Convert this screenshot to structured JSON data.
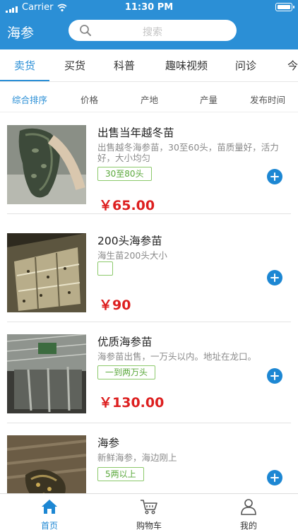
{
  "status_bar": {
    "carrier": "Carrier",
    "time": "11:30 PM"
  },
  "header": {
    "title": "海参",
    "search_placeholder": "搜索",
    "search_icon": "search-icon"
  },
  "tabs": [
    {
      "label": "卖货",
      "active": true
    },
    {
      "label": "买货"
    },
    {
      "label": "科普"
    },
    {
      "label": "趣味视频"
    },
    {
      "label": "问诊"
    },
    {
      "label": "今"
    }
  ],
  "sort_options": [
    {
      "label": "综合排序",
      "active": true
    },
    {
      "label": "价格"
    },
    {
      "label": "产地"
    },
    {
      "label": "产量"
    },
    {
      "label": "发布时间"
    }
  ],
  "listings": [
    {
      "title": "出售当年越冬苗",
      "description": "出售越冬海参苗，30至60头，苗质量好，活力好，大小均匀",
      "tag": "30至80头",
      "price": "￥65.00"
    },
    {
      "title": "200头海参苗",
      "description": "海生苗200头大小",
      "tag": "",
      "price": "￥90"
    },
    {
      "title": "优质海参苗",
      "description": "海参苗出售，一万头以内。地址在龙口。",
      "tag": "一到两万头",
      "price": "￥130.00"
    },
    {
      "title": "海参",
      "description": "新鲜海参，海边刚上",
      "tag": "5两以上",
      "price": ""
    }
  ],
  "tabbar": [
    {
      "label": "首页",
      "icon": "home-icon",
      "active": true
    },
    {
      "label": "购物车",
      "icon": "cart-icon"
    },
    {
      "label": "我的",
      "icon": "user-icon"
    }
  ],
  "colors": {
    "accent": "#2b8fd6",
    "price": "#dd1f1f",
    "tag": "#5aa83b"
  }
}
